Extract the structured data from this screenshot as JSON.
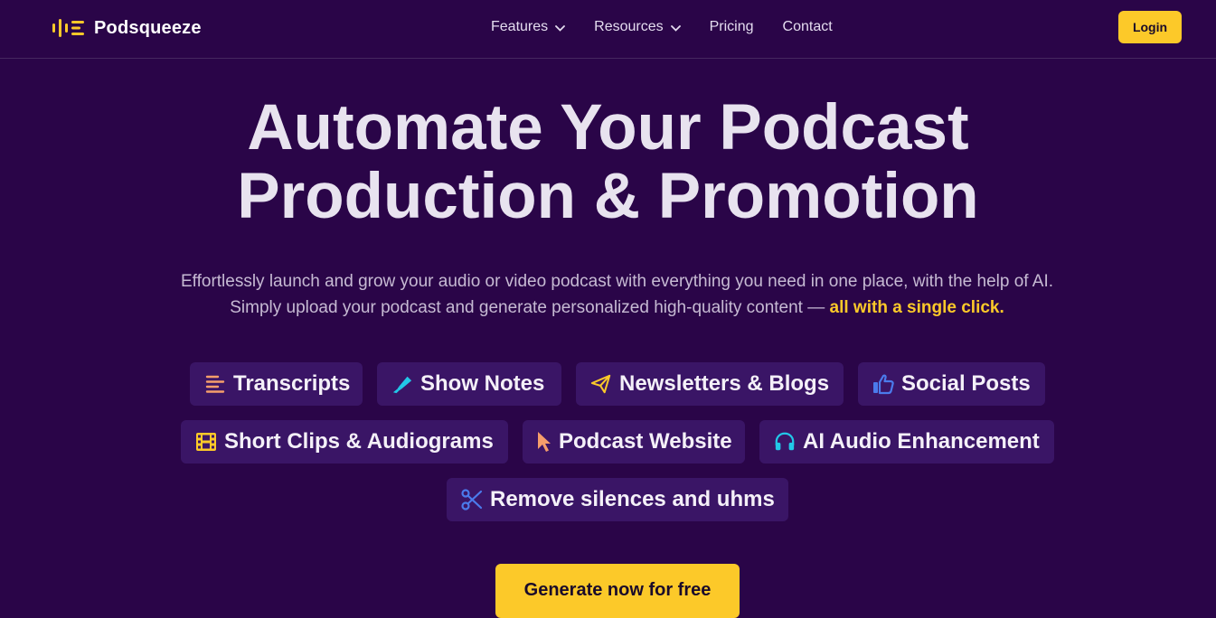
{
  "brand": {
    "name": "Podsqueeze",
    "accent": "#fcc929"
  },
  "nav": {
    "items": [
      {
        "label": "Features",
        "dropdown": true
      },
      {
        "label": "Resources",
        "dropdown": true
      },
      {
        "label": "Pricing",
        "dropdown": false
      },
      {
        "label": "Contact",
        "dropdown": false
      }
    ],
    "login_label": "Login"
  },
  "hero": {
    "title_line1": "Automate Your Podcast",
    "title_line2": "Production & Promotion",
    "subtitle_line1": "Effortlessly launch and grow your audio or video podcast with everything you need in one place, with the help of AI.",
    "subtitle_line2": "Simply upload your podcast and generate personalized high-quality content — ",
    "subtitle_highlight": "all with a single click."
  },
  "features": [
    {
      "label": "Transcripts",
      "icon": "align-left-icon",
      "color": "#f59e6b"
    },
    {
      "label": "Show Notes",
      "icon": "highlighter-icon",
      "color": "#22c7e8"
    },
    {
      "label": "Newsletters & Blogs",
      "icon": "paper-plane-icon",
      "color": "#fcc929"
    },
    {
      "label": "Social Posts",
      "icon": "thumbs-up-icon",
      "color": "#4b7bec"
    },
    {
      "label": "Short Clips & Audiograms",
      "icon": "film-icon",
      "color": "#fcc929"
    },
    {
      "label": "Podcast Website",
      "icon": "cursor-icon",
      "color": "#f59e6b"
    },
    {
      "label": "AI Audio Enhancement",
      "icon": "headphones-icon",
      "color": "#22c7e8"
    },
    {
      "label": "Remove silences and uhms",
      "icon": "scissors-icon",
      "color": "#4b7bec"
    }
  ],
  "cta": {
    "label": "Generate now for free"
  }
}
